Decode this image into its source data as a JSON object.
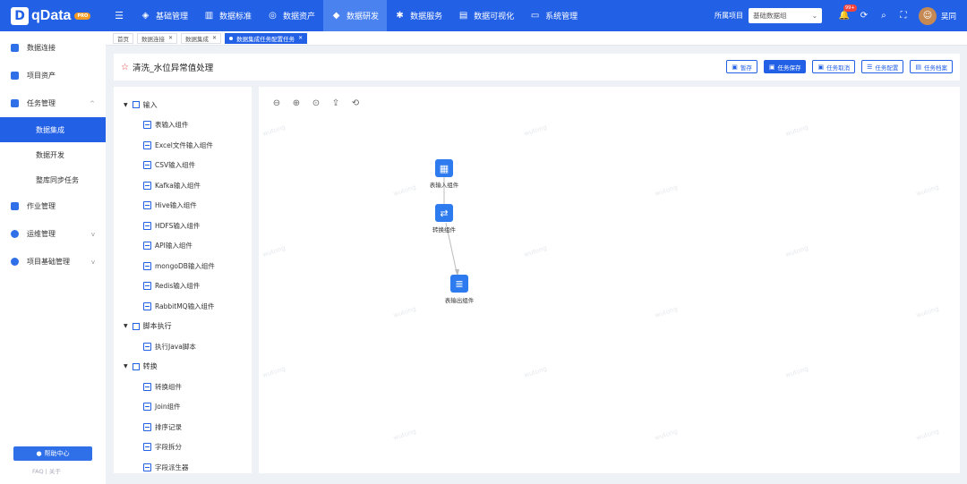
{
  "header": {
    "logo_mark": "D",
    "logo_text": "qData",
    "logo_badge": "PRO",
    "nav": [
      {
        "label": "基础管理",
        "icon": "cube-icon",
        "glyph": "◈",
        "active": false
      },
      {
        "label": "数据标准",
        "icon": "book-icon",
        "glyph": "▥",
        "active": false
      },
      {
        "label": "数据资产",
        "icon": "target-icon",
        "glyph": "◎",
        "active": false
      },
      {
        "label": "数据研发",
        "icon": "box-icon",
        "glyph": "◆",
        "active": true
      },
      {
        "label": "数据服务",
        "icon": "service-icon",
        "glyph": "✱",
        "active": false
      },
      {
        "label": "数据可视化",
        "icon": "chart-icon",
        "glyph": "▤",
        "active": false
      },
      {
        "label": "系统管理",
        "icon": "monitor-icon",
        "glyph": "▭",
        "active": false
      }
    ],
    "project_label": "所属项目",
    "project_value": "基础数据组",
    "notification_badge": "99+",
    "username": "吴同"
  },
  "sidebar": {
    "items": [
      {
        "label": "数据连接",
        "icon": "connection-icon",
        "color": "#2f6fe8"
      },
      {
        "label": "项目资产",
        "icon": "asset-icon",
        "color": "#2f6fe8"
      },
      {
        "label": "任务管理",
        "icon": "task-icon",
        "color": "#2f6fe8",
        "arrow": "^"
      }
    ],
    "sub_items": [
      {
        "label": "数据集成",
        "active": true
      },
      {
        "label": "数据开发",
        "active": false
      },
      {
        "label": "整库同步任务",
        "active": false
      }
    ],
    "items_after": [
      {
        "label": "作业管理",
        "icon": "job-icon",
        "color": "#2f6fe8"
      },
      {
        "label": "运维管理",
        "icon": "ops-icon",
        "color": "#2f6fe8",
        "arrow": "v"
      },
      {
        "label": "项目基础管理",
        "icon": "project-icon",
        "color": "#2f6fe8",
        "arrow": "v"
      }
    ],
    "help_label": "帮助中心",
    "footer_text": "FAQ | 关于"
  },
  "tabs": [
    {
      "label": "首页",
      "closable": false,
      "active": false
    },
    {
      "label": "数据连接",
      "closable": true,
      "active": false
    },
    {
      "label": "数据集成",
      "closable": true,
      "active": false
    },
    {
      "label": "数据集成任务配置任务",
      "closable": true,
      "active": true
    }
  ],
  "title": {
    "text": "清洗_水位异常值处理",
    "buttons": [
      {
        "label": "暂存",
        "primary": false,
        "icon": "save-draft-icon"
      },
      {
        "label": "任务保存",
        "primary": true,
        "icon": "save-icon"
      },
      {
        "label": "任务取消",
        "primary": false,
        "icon": "cancel-icon"
      },
      {
        "label": "任务配置",
        "primary": false,
        "icon": "config-icon"
      },
      {
        "label": "任务档案",
        "primary": false,
        "icon": "archive-icon"
      }
    ]
  },
  "tree": [
    {
      "group": "输入",
      "icon": "table-icon",
      "children": [
        "表输入组件",
        "Excel文件输入组件",
        "CSV输入组件",
        "Kafka输入组件",
        "Hive输入组件",
        "HDFS输入组件",
        "API输入组件",
        "mongoDB输入组件",
        "Redis输入组件",
        "RabbitMQ输入组件"
      ]
    },
    {
      "group": "脚本执行",
      "icon": "script-icon",
      "children": [
        "执行Java脚本"
      ]
    },
    {
      "group": "转换",
      "icon": "transform-icon",
      "children": [
        "转换组件",
        "Join组件",
        "排序记录",
        "字段拆分",
        "字段派生器"
      ]
    }
  ],
  "canvas": {
    "watermark": "wutong",
    "nodes": [
      {
        "label": "表输入组件",
        "icon": "table-icon",
        "glyph": "▦"
      },
      {
        "label": "转换组件",
        "icon": "transform-icon",
        "glyph": "⇄"
      },
      {
        "label": "表输出组件",
        "icon": "output-icon",
        "glyph": "≣"
      }
    ]
  }
}
